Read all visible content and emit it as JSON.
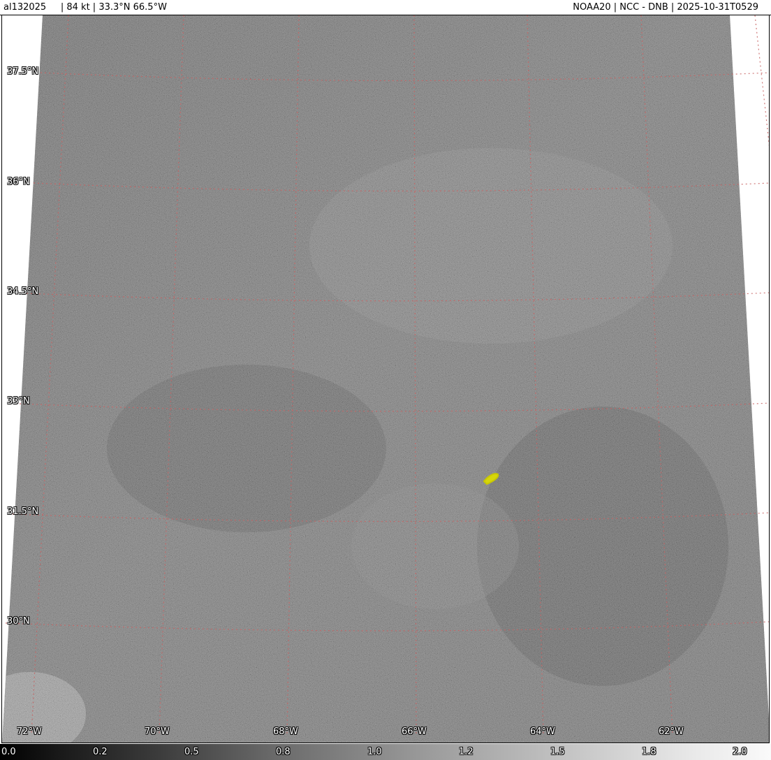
{
  "header": {
    "storm_info": "al132025     | 84 kt | 33.3°N 66.5°W",
    "product_info": "NOAA20 | NCC - DNB | 2025-10-31T0529"
  },
  "map": {
    "lat_labels": [
      "37.5°N",
      "36°N",
      "34.5°N",
      "33°N",
      "31.5°N",
      "30°N"
    ],
    "lon_labels": [
      "72°W",
      "70°W",
      "68°W",
      "66°W",
      "64°W",
      "62°W"
    ],
    "grid_color": "#c86464",
    "storm_marker_color": "#d6d60a"
  },
  "colorbar": {
    "ticks": [
      "0.0",
      "0.2",
      "0.5",
      "0.8",
      "1.0",
      "1.2",
      "1.5",
      "1.8",
      "2.0"
    ]
  }
}
